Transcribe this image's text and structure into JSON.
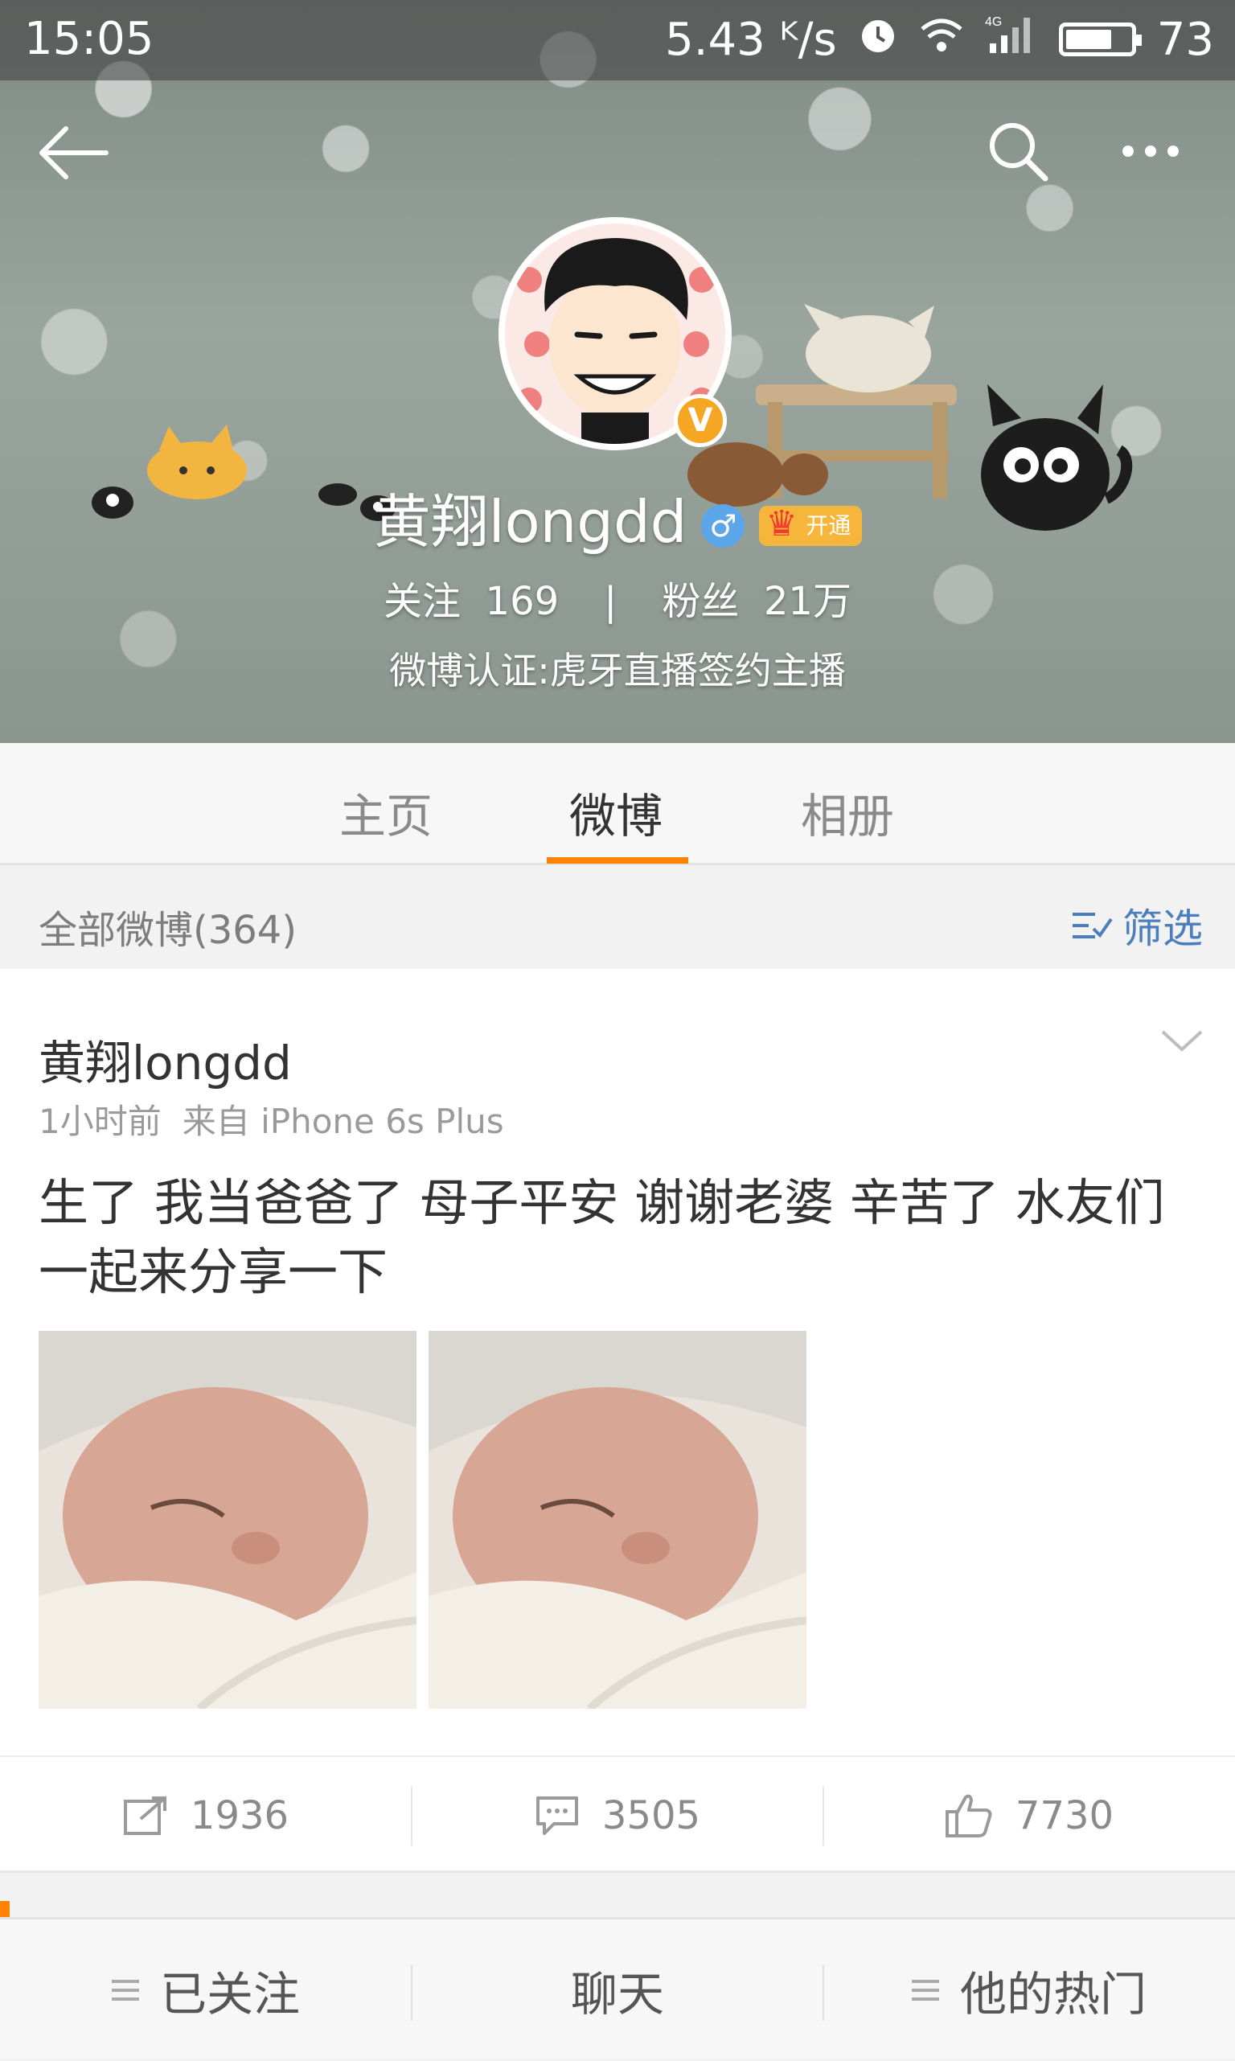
{
  "status_bar": {
    "time": "15:05",
    "speed": "5.43 ᴷ/s",
    "battery": "73"
  },
  "profile": {
    "name": "黄翔longdd",
    "vip_badge": "开通",
    "follow_label": "关注",
    "follow_count": "169",
    "fans_label": "粉丝",
    "fans_count": "21万",
    "verification": "微博认证:虎牙直播签约主播",
    "verify_mark": "V",
    "gender_symbol": "♂"
  },
  "tabs": [
    {
      "label": "主页"
    },
    {
      "label": "微博"
    },
    {
      "label": "相册"
    }
  ],
  "filter_bar": {
    "count_label": "全部微博(364)",
    "filter_label": "筛选"
  },
  "post": {
    "author": "黄翔longdd",
    "time": "1小时前",
    "source": "来自 iPhone 6s Plus",
    "text": "生了 我当爸爸了 母子平安  谢谢老婆 辛苦了 水友们一起来分享一下",
    "repost_count": "1936",
    "comment_count": "3505",
    "like_count": "7730"
  },
  "bottom_bar": {
    "following": "已关注",
    "chat": "聊天",
    "his_hot": "他的热门"
  },
  "colors": {
    "accent": "#ff8200",
    "link_blue": "#4b7fbb"
  }
}
